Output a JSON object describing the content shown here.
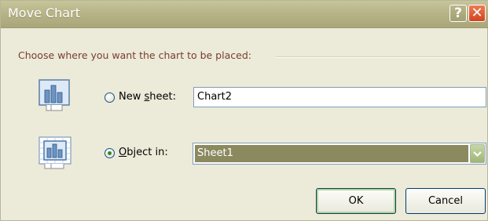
{
  "window": {
    "title": "Move Chart",
    "help_label": "?",
    "close_label": "✕"
  },
  "section": {
    "label": "Choose where you want the chart to be placed:"
  },
  "options": {
    "new_sheet": {
      "label_pre": "New ",
      "label_accel": "s",
      "label_post": "heet:",
      "value": "Chart2",
      "selected": false,
      "icon": "chart-new-sheet-icon"
    },
    "object_in": {
      "label_pre": "",
      "label_accel": "O",
      "label_post": "bject in:",
      "value": "Sheet1",
      "selected": true,
      "icon": "chart-embedded-icon"
    }
  },
  "buttons": {
    "ok": "OK",
    "cancel": "Cancel"
  },
  "colors": {
    "titlebar": "#b7b488",
    "dialog_bg": "#ecead9",
    "section_text": "#7a3d2e",
    "selection": "#8b8a5f"
  }
}
